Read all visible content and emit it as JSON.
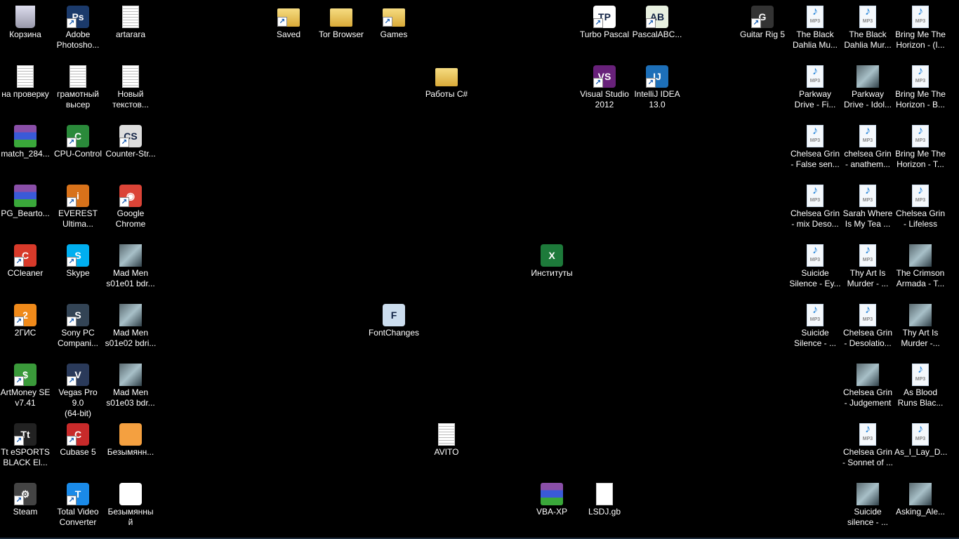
{
  "icons": [
    {
      "label": "Корзина",
      "icon": "recycle-bin-icon"
    },
    {
      "label": "Adobe\nPhotosho...",
      "icon": "photoshop-icon"
    },
    {
      "label": "artarara",
      "icon": "text-file-icon"
    },
    {
      "label": "Saved",
      "icon": "folder-icon"
    },
    {
      "label": "Tor Browser",
      "icon": "folder-icon"
    },
    {
      "label": "Games",
      "icon": "folder-icon"
    },
    {
      "label": "Turbo Pascal",
      "icon": "turbo-pascal-icon"
    },
    {
      "label": "PascalABC...",
      "icon": "pascalabc-icon"
    },
    {
      "label": "Guitar Rig 5",
      "icon": "guitar-rig-icon"
    },
    {
      "label": "The Black\nDahlia Mu...",
      "icon": "mp3-file-icon"
    },
    {
      "label": "The Black\nDahlia Mur...",
      "icon": "mp3-file-icon"
    },
    {
      "label": "Bring Me The\nHorizon - (I...",
      "icon": "mp3-file-icon"
    },
    {
      "label": "на проверку",
      "icon": "text-file-icon"
    },
    {
      "label": "грамотный\nвысер",
      "icon": "text-file-icon"
    },
    {
      "label": "Новый\nтекстов...",
      "icon": "text-file-icon"
    },
    {
      "label": "Работы C#",
      "icon": "folder-icon"
    },
    {
      "label": "Visual Studio\n2012",
      "icon": "visual-studio-icon"
    },
    {
      "label": "IntelliJ IDEA\n13.0",
      "icon": "intellij-icon"
    },
    {
      "label": "Parkway\nDrive - Fi...",
      "icon": "mp3-file-icon"
    },
    {
      "label": "Parkway\nDrive - Idol...",
      "icon": "image-thumbnail-icon"
    },
    {
      "label": "Bring Me The\nHorizon - B...",
      "icon": "mp3-file-icon"
    },
    {
      "label": "match_284...",
      "icon": "winrar-archive-icon"
    },
    {
      "label": "CPU-Control",
      "icon": "cpu-control-icon"
    },
    {
      "label": "Counter-Str...",
      "icon": "counter-strike-icon"
    },
    {
      "label": "Chelsea Grin\n- False sen...",
      "icon": "mp3-file-icon"
    },
    {
      "label": "chelsea Grin\n- anathem...",
      "icon": "mp3-file-icon"
    },
    {
      "label": "Bring Me The\nHorizon - T...",
      "icon": "mp3-file-icon"
    },
    {
      "label": "PG_Bearto...",
      "icon": "winrar-archive-icon"
    },
    {
      "label": "EVEREST\nUltima...",
      "icon": "everest-icon"
    },
    {
      "label": "Google\nChrome",
      "icon": "chrome-icon"
    },
    {
      "label": "Chelsea Grin\n- mix Deso...",
      "icon": "mp3-file-icon"
    },
    {
      "label": "Sarah Where\nIs My Tea ...",
      "icon": "mp3-file-icon"
    },
    {
      "label": "Chelsea Grin\n- Lifeless",
      "icon": "mp3-file-icon"
    },
    {
      "label": "CCleaner",
      "icon": "ccleaner-icon"
    },
    {
      "label": "Skype",
      "icon": "skype-icon"
    },
    {
      "label": "Mad Men\ns01e01 bdr...",
      "icon": "video-file-icon"
    },
    {
      "label": "Институты",
      "icon": "excel-file-icon"
    },
    {
      "label": "Suicide\nSilence - Ey...",
      "icon": "mp3-file-icon"
    },
    {
      "label": "Thy Art Is\nMurder - ...",
      "icon": "mp3-file-icon"
    },
    {
      "label": "The Crimson\nArmada - T...",
      "icon": "image-thumbnail-icon"
    },
    {
      "label": "2ГИС",
      "icon": "2gis-icon"
    },
    {
      "label": "Sony PC\nCompani...",
      "icon": "sony-pc-companion-icon"
    },
    {
      "label": "Mad Men\ns01e02 bdri...",
      "icon": "video-file-icon"
    },
    {
      "label": "FontChanges",
      "icon": "application-icon"
    },
    {
      "label": "Suicide\nSilence - ...",
      "icon": "mp3-file-icon"
    },
    {
      "label": "Chelsea Grin\n- Desolatio...",
      "icon": "mp3-file-icon"
    },
    {
      "label": "Thy Art Is\nMurder -...",
      "icon": "image-thumbnail-icon"
    },
    {
      "label": "ArtMoney SE\nv7.41",
      "icon": "artmoney-icon"
    },
    {
      "label": "Vegas Pro 9.0\n(64-bit)",
      "icon": "vegas-pro-icon"
    },
    {
      "label": "Mad Men\ns01e03 bdr...",
      "icon": "video-file-icon"
    },
    {
      "label": "Chelsea Grin\n- Judgement",
      "icon": "image-thumbnail-icon"
    },
    {
      "label": "As Blood\nRuns Blac...",
      "icon": "mp3-file-icon"
    },
    {
      "label": "Tt eSPORTS\nBLACK El...",
      "icon": "tt-esports-icon"
    },
    {
      "label": "Cubase 5",
      "icon": "cubase-icon"
    },
    {
      "label": "Безымянн...",
      "icon": "image-file-icon"
    },
    {
      "label": "AVITO",
      "icon": "text-file-icon"
    },
    {
      "label": "Chelsea Grin\n- Sonnet of ...",
      "icon": "mp3-file-icon"
    },
    {
      "label": "As_I_Lay_D...",
      "icon": "mp3-file-icon"
    },
    {
      "label": "Steam",
      "icon": "steam-icon"
    },
    {
      "label": "Total Video\nConverter",
      "icon": "total-video-converter-icon"
    },
    {
      "label": "Безымянны\nй",
      "icon": "image-file-icon"
    },
    {
      "label": "VBA-XP",
      "icon": "winrar-archive-icon"
    },
    {
      "label": "LSDJ.gb",
      "icon": "blank-file-icon"
    },
    {
      "label": "Suicide\nsilence - ...",
      "icon": "image-thumbnail-icon"
    },
    {
      "label": "Asking_Ale...",
      "icon": "image-thumbnail-icon"
    }
  ],
  "colors": {
    "desktop": "#000000",
    "label": "#ffffff"
  }
}
